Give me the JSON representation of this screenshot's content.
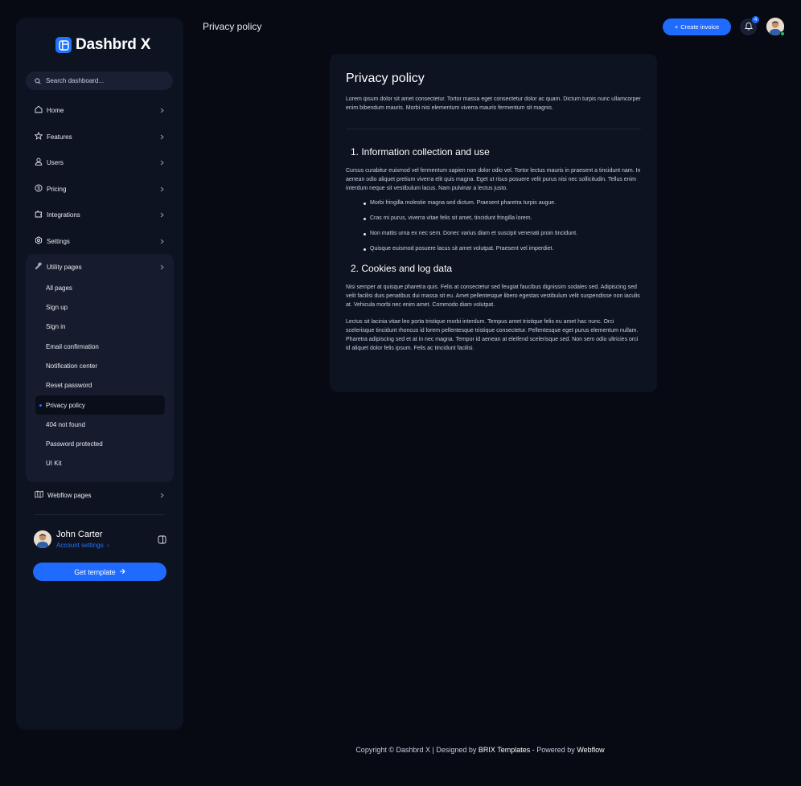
{
  "brand": {
    "name": "Dashbrd X",
    "accent": "#1f6bff"
  },
  "search": {
    "placeholder": "Search dashboard..."
  },
  "nav": [
    {
      "label": "Home",
      "icon": "home-icon"
    },
    {
      "label": "Features",
      "icon": "star-icon"
    },
    {
      "label": "Users",
      "icon": "user-icon"
    },
    {
      "label": "Pricing",
      "icon": "dollar-icon"
    },
    {
      "label": "Integrations",
      "icon": "puzzle-icon"
    },
    {
      "label": "Settings",
      "icon": "gear-icon"
    },
    {
      "label": "Utility pages",
      "icon": "wrench-icon"
    }
  ],
  "utility_items": [
    "All pages",
    "Sign up",
    "Sign in",
    "Email confirmation",
    "Notification center",
    "Reset password",
    "Privacy policy",
    "404 not found",
    "Password protected",
    "UI Kit"
  ],
  "utility_active": "Privacy policy",
  "webflow": {
    "label": "Webflow pages"
  },
  "user": {
    "name": "John Carter",
    "account_link": "Account settings"
  },
  "get_template": "Get template",
  "header": {
    "title": "Privacy policy",
    "create_label": "Create invoice",
    "notifications": "4"
  },
  "article": {
    "title": "Privacy policy",
    "intro": "Lorem ipsum dolor sit amet consectetur. Tortor massa eget consectetur dolor ac quam. Dictum turpis nunc ullamcorper enim bibendum mauris. Morbi nisi elementum viverra mauris fermentum sit magnis.",
    "section1": {
      "heading": "1. Information collection and use",
      "body": "Cursus curabitur euismod vel fermentum sapien non dolor odio vel. Tortor lectus mauris in praesent a tincidunt nam. In aenean odio aliquet pretium viverra elit quis magna. Eget ut risus posuere velit purus nisi nec sollicitudin. Tellus enim interdum neque sit vestibulum lacus. Nam pulvinar a lectus justo.",
      "bullets": [
        "Morbi fringilla molestie magna sed dictum. Praesent pharetra turpis augue.",
        "Cras mi purus, viverra vitae felis sit amet, tincidunt fringilla lorem.",
        "Non mattis urna ex nec sem. Donec varius diam et suscipit venenati proin tincidunt.",
        "Quisque euismod posuere lacus sit amet volutpat. Praesent vel imperdiet."
      ]
    },
    "section2": {
      "heading": "2. Cookies and log data",
      "body1": "Nisi semper at quisque pharetra quis. Felis at consectetur sed feugiat faucibus dignissim sodales sed. Adipiscing sed velit facilisi duis penatibus dui massa sit eu. Amet pellentesque libero egestas vestibulum velit suspendisse non iaculis at. Vehicula morbi nec enim amet. Commodo diam volutpat.",
      "body2": "Lectus sit lacinia vitae leo porta tristique morbi interdum. Tempus amet tristique felis eu amet hac nunc. Orci scelerisque tincidunt rhoncus id lorem pellentesque tristique consectetur. Pellentesque eget purus elementum nullam. Pharetra adipiscing sed et at in nec magna. Tempor id aenean at eleifend scelerisque sed. Non sem odio ultricies orci id aliquet dolor felis ipsum. Felis ac tincidunt facilisi."
    }
  },
  "footer": {
    "prefix": "Copyright © Dashbrd X | Designed by",
    "brix": "BRIX Templates",
    "middle": "- Powered by",
    "webflow": "Webflow"
  }
}
